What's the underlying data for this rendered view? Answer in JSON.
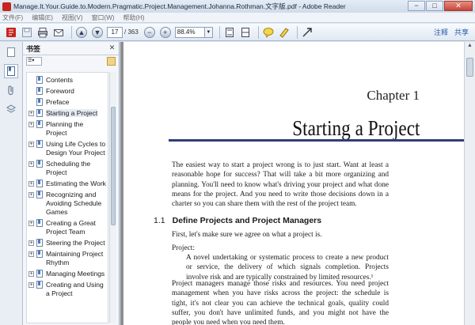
{
  "window": {
    "title": "Manage.It.Your.Guide.to.Modern.Pragmatic.Project.Management.Johanna.Rothman.文字版.pdf - Adobe Reader",
    "controls": {
      "minimize": "−",
      "maximize": "□",
      "close": "✕"
    }
  },
  "menu": [
    "文件(F)",
    "编辑(E)",
    "视图(V)",
    "窗口(W)",
    "帮助(H)"
  ],
  "toolbar": {
    "page_current": "17",
    "page_total": "/ 363",
    "zoom": "88.4%",
    "comment_label": "注释",
    "share_label": "共享"
  },
  "bookmarks_panel": {
    "title": "书签",
    "items": [
      {
        "label": "Contents",
        "expandable": false
      },
      {
        "label": "Foreword",
        "expandable": false
      },
      {
        "label": "Preface",
        "expandable": false
      },
      {
        "label": "Starting a Project",
        "expandable": true,
        "selected": true
      },
      {
        "label": "Planning the Project",
        "expandable": true
      },
      {
        "label": "Using Life Cycles to Design Your Project",
        "expandable": true
      },
      {
        "label": "Scheduling the Project",
        "expandable": true
      },
      {
        "label": "Estimating the Work",
        "expandable": true
      },
      {
        "label": "Recognizing and Avoiding Schedule Games",
        "expandable": true
      },
      {
        "label": "Creating a Great Project Team",
        "expandable": true
      },
      {
        "label": "Steering the Project",
        "expandable": true
      },
      {
        "label": "Maintaining Project Rhythm",
        "expandable": true
      },
      {
        "label": "Managing Meetings",
        "expandable": true
      },
      {
        "label": "Creating and Using a Project",
        "expandable": true
      }
    ]
  },
  "document": {
    "chapter_label": "Chapter 1",
    "chapter_title": "Starting a Project",
    "intro": "The easiest way to start a project wrong is to just start. Want at least a reasonable hope for success? That will take a bit more organizing and planning. You'll need to know what's driving your project and what done means for the project. And you need to write those decisions down in a charter so you can share them with the rest of the project team.",
    "section_number": "1.1",
    "section_title": "Define Projects and Project Managers",
    "p_first": "First, let's make sure we agree on what a project is.",
    "p_project": "Project:",
    "definition": "A novel undertaking or systematic process to create a new product or service, the delivery of which signals completion. Projects involve risk and are typically constrained by limited resources.¹",
    "p_managers": "Project managers manage those risks and resources. You need project management when you have risks across the project: the schedule is tight, it's not clear you can achieve the technical goals, quality could suffer, you don't have unlimited funds, and you might not have the people you need when you need them."
  }
}
